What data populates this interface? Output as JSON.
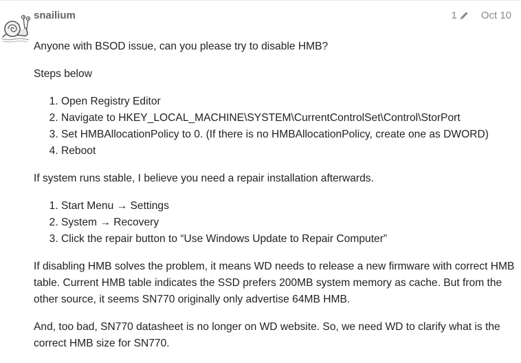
{
  "post": {
    "username": "snailium",
    "edit_count": "1",
    "date": "Oct 10"
  },
  "content": {
    "intro": "Anyone with BSOD issue, can you please try to disable HMB?",
    "steps_heading": "Steps below",
    "steps": [
      "Open Registry Editor",
      "Navigate to HKEY_LOCAL_MACHINE\\SYSTEM\\CurrentControlSet\\Control\\StorPort",
      "Set HMBAllocationPolicy to 0. (If there is no HMBAllocationPolicy, create one as DWORD)",
      "Reboot"
    ],
    "stable_note": "If system runs stable, I believe you need a repair installation afterwards.",
    "repair_steps": [
      "Start Menu → Settings",
      "System → Recovery",
      "Click the repair button to “Use Windows Update to Repair Computer”"
    ],
    "firmware_para": "If disabling HMB solves the problem, it means WD needs to release a new firmware with correct HMB table. Current HMB table indicates the SSD prefers 200MB system memory as cache. But from the other source, it seems SN770 originally only advertise 64MB HMB.",
    "datasheet_para": "And, too bad, SN770 datasheet is no longer on WD website. So, we need WD to clarify what is the correct HMB size for SN770."
  },
  "icons": {
    "avatar": "snail-avatar",
    "edit": "pencil-icon"
  },
  "colors": {
    "username": "#646464",
    "meta": "#8a8a8a",
    "text": "#222222"
  }
}
